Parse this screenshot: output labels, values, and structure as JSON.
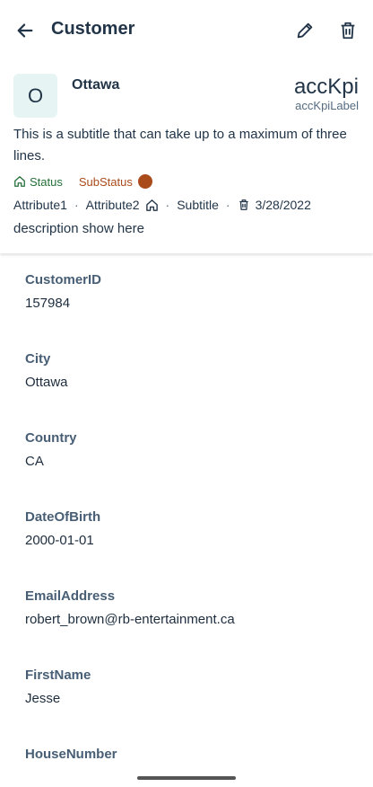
{
  "appbar": {
    "title": "Customer",
    "back_icon": "arrow-left-icon",
    "edit_icon": "pencil-icon",
    "delete_icon": "trash-icon"
  },
  "header": {
    "avatar_initial": "O",
    "title": "Ottawa",
    "kpi": "accKpi",
    "kpi_label": "accKpiLabel",
    "subtitle": "This is a subtitle that can take up to a maximum of three lines.",
    "status": "Status",
    "substatus": "SubStatus",
    "attribute1": "Attribute1",
    "attribute2": "Attribute2",
    "attr_subtitle": "Subtitle",
    "date": "3/28/2022",
    "description": "description show here",
    "colors": {
      "status": "#256f3a",
      "substatus": "#aa4b1b",
      "avatar_bg": "#e6f5f3"
    }
  },
  "fields": [
    {
      "label": "CustomerID",
      "value": "157984"
    },
    {
      "label": "City",
      "value": "Ottawa"
    },
    {
      "label": "Country",
      "value": "CA"
    },
    {
      "label": "DateOfBirth",
      "value": "2000-01-01"
    },
    {
      "label": "EmailAddress",
      "value": "robert_brown@rb-entertainment.ca"
    },
    {
      "label": "FirstName",
      "value": "Jesse"
    },
    {
      "label": "HouseNumber",
      "value": ""
    }
  ]
}
